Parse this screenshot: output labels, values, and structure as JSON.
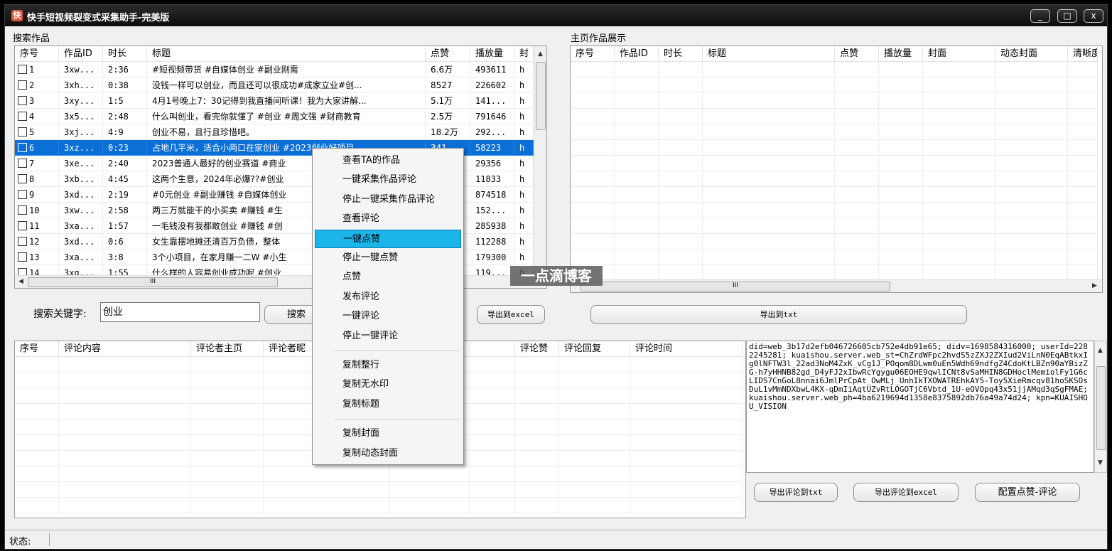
{
  "window": {
    "title": "快手短视频裂变式采集助手-完美版",
    "minimize": "_",
    "maximize": "□",
    "close": "x"
  },
  "search_panel": {
    "label": "搜索作品",
    "columns": [
      "序号",
      "作品ID",
      "时长",
      "标题",
      "点赞",
      "播放量",
      "封"
    ],
    "rows": [
      {
        "no": "1",
        "id": "3xw...",
        "dur": "2:36",
        "title": "#短视频带货 #自媒体创业 #副业刚需",
        "likes": "6.6万",
        "plays": "493611",
        "cover": "h"
      },
      {
        "no": "2",
        "id": "3xh...",
        "dur": "0:38",
        "title": "没钱一样可以创业，而且还可以很成功#成家立业#创...",
        "likes": "8527",
        "plays": "226602",
        "cover": "h"
      },
      {
        "no": "3",
        "id": "3xy...",
        "dur": "1:5",
        "title": "4月1号晚上7：30记得到我直播间听课！我为大家讲解...",
        "likes": "5.1万",
        "plays": "141...",
        "cover": "h"
      },
      {
        "no": "4",
        "id": "3x5...",
        "dur": "2:48",
        "title": "什么叫创业，看完你就懂了 #创业 #周文强 #财商教育",
        "likes": "2.5万",
        "plays": "791646",
        "cover": "h"
      },
      {
        "no": "5",
        "id": "3xj...",
        "dur": "4:9",
        "title": "创业不易，且行且珍惜吧。",
        "likes": "18.2万",
        "plays": "292...",
        "cover": "h"
      },
      {
        "no": "6",
        "id": "3xz...",
        "dur": "0:23",
        "title": "占地几平米，适合小两口在家创业 #2023创业好项目",
        "likes": "341",
        "plays": "58223",
        "cover": "h"
      },
      {
        "no": "7",
        "id": "3xe...",
        "dur": "2:40",
        "title": "2023普通人最好的创业赛道 #商业",
        "likes": "",
        "plays": "29356",
        "cover": "h"
      },
      {
        "no": "8",
        "id": "3xb...",
        "dur": "4:45",
        "title": "这两个生意，2024年必爆??#创业",
        "likes": "",
        "plays": "11833",
        "cover": "h"
      },
      {
        "no": "9",
        "id": "3xd...",
        "dur": "2:19",
        "title": "#0元创业 #副业赚钱 #自媒体创业",
        "likes": "",
        "plays": "874518",
        "cover": "h"
      },
      {
        "no": "10",
        "id": "3xw...",
        "dur": "2:58",
        "title": "两三万就能干的小买卖 #赚钱 #生",
        "likes": "",
        "plays": "152...",
        "cover": "h"
      },
      {
        "no": "11",
        "id": "3xa...",
        "dur": "1:57",
        "title": "一毛钱没有我都敢创业 #赚钱 #创",
        "likes": "",
        "plays": "285938",
        "cover": "h"
      },
      {
        "no": "12",
        "id": "3xd...",
        "dur": "0:6",
        "title": "女生靠摆地摊还清百万负债，整体",
        "likes": "",
        "plays": "112288",
        "cover": "h"
      },
      {
        "no": "13",
        "id": "3xa...",
        "dur": "3:8",
        "title": "3个小项目，在家月赚一二W #小生",
        "likes": "",
        "plays": "179300",
        "cover": "h"
      },
      {
        "no": "14",
        "id": "3xg...",
        "dur": "1:55",
        "title": "什么样的人容易创业成功呢 #创业",
        "likes": "",
        "plays": "119...",
        "cover": "h"
      }
    ],
    "hscroll_marker": "III",
    "keyword_label": "搜索关键字:",
    "keyword_value": "创业",
    "search_button": "搜索",
    "export_excel_button": "导出到excel"
  },
  "home_panel": {
    "label": "主页作品展示",
    "columns": [
      "序号",
      "作品ID",
      "时长",
      "标题",
      "点赞",
      "播放量",
      "封面",
      "动态封面",
      "清晰度"
    ],
    "hscroll_marker": "III",
    "export_txt_button": "导出到txt"
  },
  "comments_panel": {
    "columns": [
      "序号",
      "评论内容",
      "评论者主页",
      "评论者昵",
      "",
      "",
      "评论赞",
      "评论回复",
      "评论时间"
    ]
  },
  "cookie": {
    "text": "did=web_3b17d2efb046726605cb752e4db91e65; didv=1698584316000; userId=2282245281; kuaishou.server.web_st=ChZrdWFpc2hvdS5zZXJ2ZXIud2ViLnN0EqABtkxIg0lNFTW3l_22ad3NoM4ZxK_vCg1J_POqom8DLwm0uEn5Wdh69ndfgZ4CdoKtLBZn90aYBizZG-h7yHHNB82gd_D4yFJ2xIbwRcYgygu06EOHE9qwlICNt8vSaMHIN8GDHoclMemiolFy1G6cLIDS7CnGoL8nnai6JmlPrCpAt_OwMLj_UnhIkTXOWATREhkAY5-Toy5XieRmcqv81hoSKSOsDuL1vMmNDXbwL4KX-qDmIiAqtUZvRtLOGOTjC6Vbtd_1U-eOVOpq43x51jjAMqd3qSgFMAE; kuaishou.server.web_ph=4ba6219694d1358e8375892db76a49a74d24; kpn=KUAISHOU_VISION"
  },
  "bottom_buttons": {
    "export_comments_txt": "导出评论到txt",
    "export_comments_excel": "导出评论到excel",
    "config_like_comment": "配置点赞-评论"
  },
  "status": {
    "label": "状态:"
  },
  "context_menu": {
    "group1": [
      "查看TA的作品",
      "一键采集作品评论",
      "停止一键采集作品评论",
      "查看评论",
      "一键点赞",
      "停止一键点赞",
      "点赞",
      "发布评论",
      "一键评论",
      "停止一键评论"
    ],
    "group2": [
      "复制整行",
      "复制无水印",
      "复制标题"
    ],
    "group3": [
      "复制封面",
      "复制动态封面"
    ],
    "highlighted": "一键点赞"
  },
  "watermark": "一点滴博客"
}
